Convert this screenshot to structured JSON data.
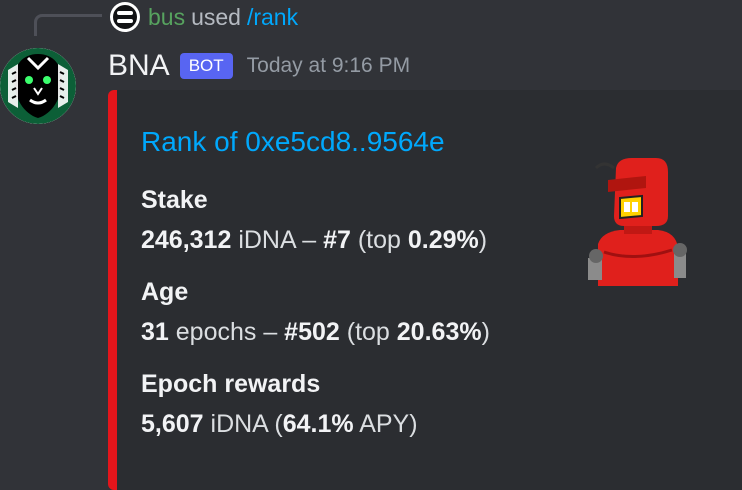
{
  "reply": {
    "user": "bus",
    "text": "used",
    "command": "/rank"
  },
  "message": {
    "username": "BNA",
    "bot_tag": "BOT",
    "timestamp": "Today at 9:16 PM"
  },
  "embed": {
    "accent_color": "#e4151b",
    "title": "Rank of 0xe5cd8..9564e",
    "stake": {
      "name": "Stake",
      "amount": "246,312",
      "unit": " iDNA – ",
      "rank": "#7",
      "top_prefix": " (top ",
      "top_value": "0.29%",
      "top_suffix": ")"
    },
    "age": {
      "name": "Age",
      "amount": "31",
      "unit": " epochs – ",
      "rank": "#502",
      "top_prefix": " (top ",
      "top_value": "20.63%",
      "top_suffix": ")"
    },
    "rewards": {
      "name": "Epoch rewards",
      "amount": "5,607",
      "unit": " iDNA (",
      "apy": "64.1%",
      "apy_suffix": " APY)"
    },
    "thumbnail_icon": "red-robot-icon"
  }
}
